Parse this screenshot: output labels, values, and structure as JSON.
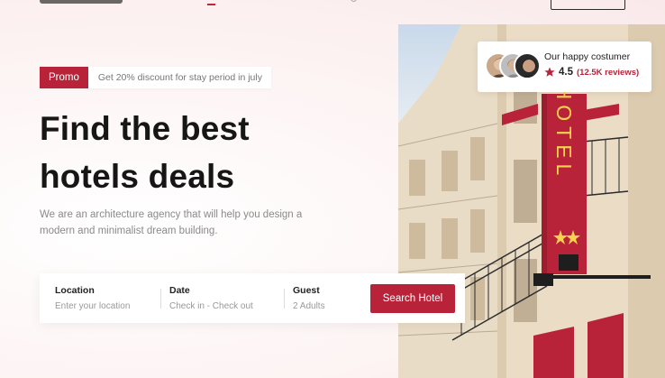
{
  "promo": {
    "tag": "Promo",
    "text": "Get 20% discount for stay period in july"
  },
  "hero": {
    "headline_line1": "Find the best",
    "headline_line2": "hotels deals",
    "subtext": "We are an architecture agency that will help you design a modern and minimalist dream building.",
    "sign_text": "HOTEL"
  },
  "reviews": {
    "title": "Our happy costumer",
    "rating": "4.5",
    "count": "(12.5K reviews)",
    "star_color": "#b8233a"
  },
  "search": {
    "location_label": "Location",
    "location_placeholder": "Enter your location",
    "date_label": "Date",
    "date_placeholder": "Check in - Check out",
    "guest_label": "Guest",
    "guest_placeholder": "2 Adults",
    "button_label": "Search Hotel"
  },
  "colors": {
    "accent": "#b8233a",
    "background": "#fdf4f4"
  }
}
